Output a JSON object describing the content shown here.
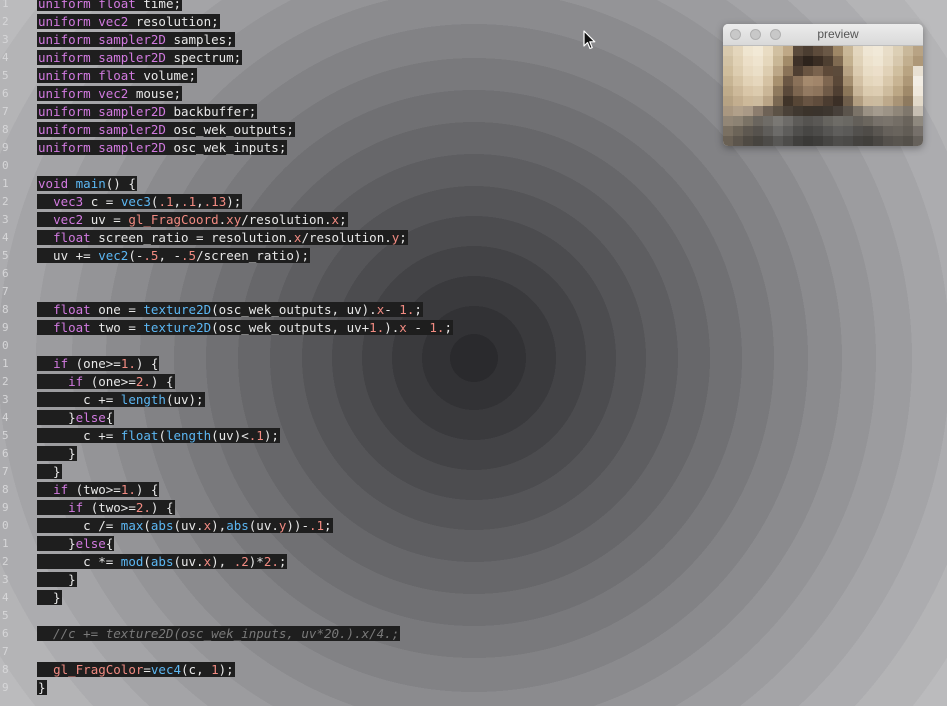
{
  "editor": {
    "lines": [
      {
        "n": "1",
        "html": "<span class=\"hl\"><span class=\"kw\">uniform float</span> time;</span>"
      },
      {
        "n": "2",
        "html": "<span class=\"hl\"><span class=\"kw\">uniform vec2</span> resolution;</span>"
      },
      {
        "n": "3",
        "html": "<span class=\"hl\"><span class=\"kw\">uniform sampler2D</span> samples;</span>"
      },
      {
        "n": "4",
        "html": "<span class=\"hl\"><span class=\"kw\">uniform sampler2D</span> spectrum;</span>"
      },
      {
        "n": "5",
        "html": "<span class=\"hl\"><span class=\"kw\">uniform float</span> volume;</span>"
      },
      {
        "n": "6",
        "html": "<span class=\"hl\"><span class=\"kw\">uniform vec2</span> mouse;</span>"
      },
      {
        "n": "7",
        "html": "<span class=\"hl\"><span class=\"kw\">uniform sampler2D</span> backbuffer;</span>"
      },
      {
        "n": "8",
        "html": "<span class=\"hl\"><span class=\"kw\">uniform sampler2D</span> osc_wek_outputs;</span>"
      },
      {
        "n": "9",
        "html": "<span class=\"hl\"><span class=\"kw\">uniform sampler2D</span> osc_wek_inputs;</span>"
      },
      {
        "n": "0",
        "html": ""
      },
      {
        "n": "1",
        "html": "<span class=\"hl\"><span class=\"kw\">void</span> <span class=\"fn\">main</span>() {</span>"
      },
      {
        "n": "2",
        "html": "<span class=\"hl\">  <span class=\"kw\">vec3</span> c = <span class=\"fn\">vec3</span>(<span class=\"num\">.1</span>,<span class=\"num\">.1</span>,<span class=\"num\">.13</span>);</span>"
      },
      {
        "n": "3",
        "html": "<span class=\"hl\">  <span class=\"kw\">vec2</span> uv = <span class=\"prop\">gl_FragCoord</span>.<span class=\"prop\">xy</span>/resolution.<span class=\"prop\">x</span>;</span>"
      },
      {
        "n": "4",
        "html": "<span class=\"hl\">  <span class=\"kw\">float</span> screen_ratio = resolution.<span class=\"prop\">x</span>/resolution.<span class=\"prop\">y</span>;</span>"
      },
      {
        "n": "5",
        "html": "<span class=\"hl\">  uv += <span class=\"fn\">vec2</span>(-<span class=\"num\">.5</span>, -<span class=\"num\">.5</span>/screen_ratio);</span>"
      },
      {
        "n": "6",
        "html": ""
      },
      {
        "n": "7",
        "html": ""
      },
      {
        "n": "8",
        "html": "<span class=\"hl\">  <span class=\"kw\">float</span> one = <span class=\"fn\">texture2D</span>(osc_wek_outputs, uv).<span class=\"prop\">x</span>- <span class=\"num\">1.</span>;</span>"
      },
      {
        "n": "9",
        "html": "<span class=\"hl\">  <span class=\"kw\">float</span> two = <span class=\"fn\">texture2D</span>(osc_wek_outputs, uv+<span class=\"num\">1.</span>).<span class=\"prop\">x</span> - <span class=\"num\">1.</span>;</span>"
      },
      {
        "n": "0",
        "html": ""
      },
      {
        "n": "1",
        "html": "<span class=\"hl\">  <span class=\"kw\">if</span> (one&gt;=<span class=\"num\">1.</span>) {</span>"
      },
      {
        "n": "2",
        "html": "<span class=\"hl\">    <span class=\"kw\">if</span> (one&gt;=<span class=\"num\">2.</span>) {</span>"
      },
      {
        "n": "3",
        "html": "<span class=\"hl\">      c += <span class=\"fn\">length</span>(uv);</span>"
      },
      {
        "n": "4",
        "html": "<span class=\"hl\">    }<span class=\"kw\">else</span>{</span>"
      },
      {
        "n": "5",
        "html": "<span class=\"hl\">      c += <span class=\"fn\">float</span>(<span class=\"fn\">length</span>(uv)&lt;<span class=\"num\">.1</span>);</span>"
      },
      {
        "n": "6",
        "html": "<span class=\"hl\">    }</span>"
      },
      {
        "n": "7",
        "html": "<span class=\"hl\">  }</span>"
      },
      {
        "n": "8",
        "html": "<span class=\"hl\">  <span class=\"kw\">if</span> (two&gt;=<span class=\"num\">1.</span>) {</span>"
      },
      {
        "n": "9",
        "html": "<span class=\"hl\">    <span class=\"kw\">if</span> (two&gt;=<span class=\"num\">2.</span>) {</span>"
      },
      {
        "n": "0",
        "html": "<span class=\"hl\">      c /= <span class=\"fn\">max</span>(<span class=\"fn\">abs</span>(uv.<span class=\"prop\">x</span>),<span class=\"fn\">abs</span>(uv.<span class=\"prop\">y</span>))-<span class=\"num\">.1</span>;</span>"
      },
      {
        "n": "1",
        "html": "<span class=\"hl\">    }<span class=\"kw\">else</span>{</span>"
      },
      {
        "n": "2",
        "html": "<span class=\"hl\">      c *= <span class=\"fn\">mod</span>(<span class=\"fn\">abs</span>(uv.<span class=\"prop\">x</span>), <span class=\"num\">.2</span>)*<span class=\"num\">2.</span>;</span>"
      },
      {
        "n": "3",
        "html": "<span class=\"hl\">    }</span>"
      },
      {
        "n": "4",
        "html": "<span class=\"hl\">  }</span>"
      },
      {
        "n": "5",
        "html": ""
      },
      {
        "n": "6",
        "html": "<span class=\"hl\"><span class=\"cm\">  //c += texture2D(osc_wek_inputs, uv*20.).x/4.;</span></span>"
      },
      {
        "n": "7",
        "html": ""
      },
      {
        "n": "8",
        "html": "<span class=\"hl\">  <span class=\"prop\">gl_FragColor</span>=<span class=\"fn\">vec4</span>(c, <span class=\"num\">1</span>);</span>"
      },
      {
        "n": "9",
        "html": "<span class=\"hl\">}</span>"
      }
    ]
  },
  "preview": {
    "title": "preview",
    "pixels": [
      "#d8c9ad",
      "#e4d6bc",
      "#efe5d0",
      "#f2e9d6",
      "#e9dcc3",
      "#d1c0a1",
      "#bfa886",
      "#5a4a3c",
      "#4b3d31",
      "#5d4b3b",
      "#6a5846",
      "#9e8766",
      "#c9b797",
      "#e3d6be",
      "#efe6d4",
      "#f1e9d8",
      "#e8ddc8",
      "#dccfb5",
      "#c9b89a",
      "#b8a384",
      "#d2c2a4",
      "#e1d2b6",
      "#ecdfc8",
      "#efe4cf",
      "#e5d7bc",
      "#c9b796",
      "#a28b69",
      "#3e3128",
      "#2d231c",
      "#3a2d23",
      "#4e3f31",
      "#7f6a51",
      "#c3b08e",
      "#e0d2b8",
      "#ede2cd",
      "#efe6d3",
      "#e6dac3",
      "#d7c8ad",
      "#c2af8f",
      "#ae9878",
      "#cfbd9c",
      "#ddcdb0",
      "#e8dac1",
      "#ebdfc8",
      "#ddcdb0",
      "#bca787",
      "#8a7358",
      "#4f3f32",
      "#6a5542",
      "#7a634e",
      "#5e4a39",
      "#5c4b3b",
      "#b7a283",
      "#dbcbb0",
      "#e9ddc6",
      "#ecdfca",
      "#e1d2b8",
      "#d0bf9f",
      "#b9a482",
      "#e8e0d2",
      "#c7b493",
      "#d6c4a5",
      "#e2d2b6",
      "#e6d7bd",
      "#d5c2a3",
      "#a8916f",
      "#6b5744",
      "#8a7159",
      "#a58a6e",
      "#a1856a",
      "#7e6650",
      "#5a4838",
      "#a48e6f",
      "#d3c1a4",
      "#e4d6bc",
      "#e7d9c1",
      "#d9c8ab",
      "#c8b493",
      "#ae9877",
      "#f2ede4",
      "#bfab8a",
      "#cdb99a",
      "#d9c6a8",
      "#dccbae",
      "#cab697",
      "#8f7a5e",
      "#5a493a",
      "#7d6650",
      "#937a62",
      "#8d745c",
      "#6f5a47",
      "#4f3f32",
      "#8b7659",
      "#c8b598",
      "#dbcbaf",
      "#ddcdb2",
      "#cebc9e",
      "#bca785",
      "#a08a6a",
      "#efe8dc",
      "#b6a283",
      "#c3ae8f",
      "#cdb99a",
      "#cdbb9e",
      "#b9a486",
      "#7a6852",
      "#403429",
      "#574636",
      "#685443",
      "#5f4c3c",
      "#4b3c30",
      "#3b2f26",
      "#6f5e4b",
      "#b19d80",
      "#cbb99d",
      "#cbbb9f",
      "#bda98b",
      "#a99476",
      "#8e7a5f",
      "#e2d9c9",
      "#a99780",
      "#b1a08a",
      "#a99986",
      "#8c7d6e",
      "#6e6256",
      "#5c5246",
      "#4a4138",
      "#403830",
      "#3b332b",
      "#3a332c",
      "#3d362f",
      "#47403a",
      "#5b544c",
      "#7b7368",
      "#9a9184",
      "#a49b8e",
      "#9c9386",
      "#8f8679",
      "#7f776c",
      "#c6beb2",
      "#928676",
      "#8c8273",
      "#7a7265",
      "#6a655e",
      "#6f6c67",
      "#7a7874",
      "#6d6b68",
      "#5d5b58",
      "#555350",
      "#5a5855",
      "#66645f",
      "#6e6c67",
      "#6a6863",
      "#635f59",
      "#6b665e",
      "#77716a",
      "#7a746c",
      "#746e66",
      "#6a645c",
      "#8e887e",
      "#7a7062",
      "#6c6458",
      "#5e5850",
      "#56524d",
      "#5f5d5a",
      "#6c6b69",
      "#5e5d5b",
      "#4f4e4c",
      "#474644",
      "#4c4b49",
      "#565553",
      "#5f5e5c",
      "#5b5a58",
      "#52504d",
      "#4f4c48",
      "#5a5651",
      "#66615b",
      "#69645d",
      "#625d56",
      "#76706a",
      "#6a6155",
      "#5c554c",
      "#4f4a43",
      "#47443f",
      "#4d4b48",
      "#585755",
      "#4d4c4a",
      "#403f3d",
      "#3a3937",
      "#3e3d3b",
      "#464543",
      "#4e4d4b",
      "#4b4a48",
      "#44423f",
      "#413f3b",
      "#4a4743",
      "#55514c",
      "#59554f",
      "#54504a",
      "#66615b"
    ]
  }
}
